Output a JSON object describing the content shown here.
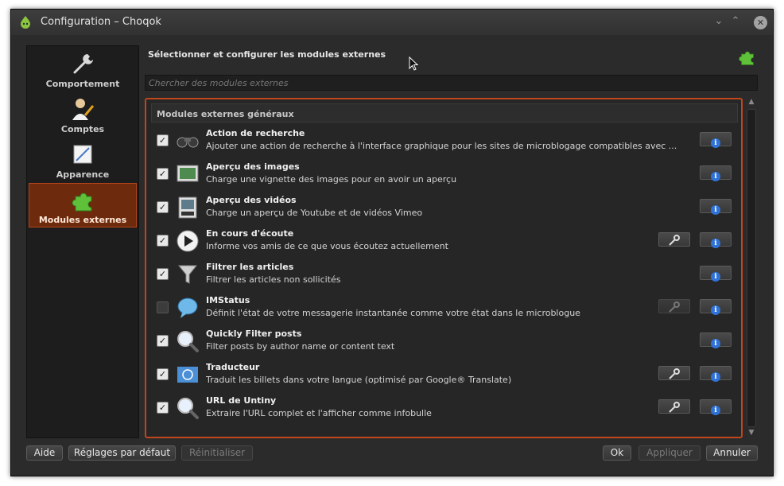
{
  "window": {
    "title": "Configuration – Choqok"
  },
  "sidebar": {
    "items": [
      {
        "label": "Comportement",
        "icon": "wrench-icon"
      },
      {
        "label": "Comptes",
        "icon": "user-pen-icon"
      },
      {
        "label": "Apparence",
        "icon": "brush-icon"
      },
      {
        "label": "Modules externes",
        "icon": "puzzle-icon",
        "active": true
      }
    ]
  },
  "header": {
    "title": "Sélectionner et configurer les modules externes"
  },
  "search": {
    "placeholder": "Chercher des modules externes"
  },
  "plugins": {
    "group_title": "Modules externes généraux",
    "items": [
      {
        "name": "Action de recherche",
        "description": "Ajouter une action de recherche à l'interface graphique pour les sites de microblogage compatibles avec ...",
        "checked": true,
        "configurable": false,
        "icon": "binoculars-icon"
      },
      {
        "name": "Aperçu des images",
        "description": "Charge une vignette des images pour en avoir un aperçu",
        "checked": true,
        "configurable": false,
        "icon": "image-preview-icon"
      },
      {
        "name": "Aperçu des vidéos",
        "description": "Charge un aperçu de Youtube et de vidéos Vimeo",
        "checked": true,
        "configurable": false,
        "icon": "video-icon"
      },
      {
        "name": "En cours d'écoute",
        "description": "Informe vos amis de ce que vous écoutez actuellement",
        "checked": true,
        "configurable": true,
        "icon": "play-icon"
      },
      {
        "name": "Filtrer les articles",
        "description": "Filtrer les articles non sollicités",
        "checked": true,
        "configurable": false,
        "icon": "funnel-icon"
      },
      {
        "name": "IMStatus",
        "description": "Définit l'état de votre messagerie instantanée comme votre état dans le microblogue",
        "checked": false,
        "configurable": true,
        "icon": "chat-bubble-icon"
      },
      {
        "name": "Quickly Filter posts",
        "description": "Filter posts by author name or content text",
        "checked": true,
        "configurable": false,
        "icon": "magnifier-icon"
      },
      {
        "name": "Traducteur",
        "description": "Traduit les billets dans votre langue (optimisé par Google® Translate)",
        "checked": true,
        "configurable": true,
        "icon": "un-flag-icon"
      },
      {
        "name": "URL de Untiny",
        "description": "Extraire l'URL complet et l'afficher comme infobulle",
        "checked": true,
        "configurable": true,
        "icon": "magnifier-icon"
      }
    ]
  },
  "footer": {
    "help": "Aide",
    "defaults": "Réglages par défaut",
    "reset": "Réinitialiser",
    "ok": "Ok",
    "apply": "Appliquer",
    "cancel": "Annuler"
  },
  "colors": {
    "accent": "#c0461c",
    "active_bg": "#6e2a0c",
    "info": "#2f73d8"
  }
}
